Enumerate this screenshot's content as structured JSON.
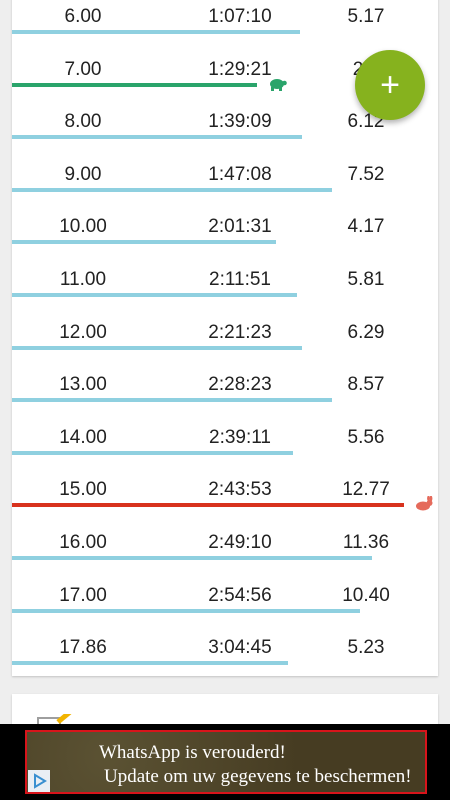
{
  "splits": [
    {
      "km": "6.00",
      "time": "1:07:10",
      "pace": "5.17",
      "bar_fraction": 0.677
    },
    {
      "km": "7.00",
      "time": "1:29:21",
      "pace": "2.7",
      "bar_fraction": 0.575,
      "marker": "turtle-icon",
      "bar_color": "#2aa46b"
    },
    {
      "km": "8.00",
      "time": "1:39:09",
      "pace": "6.12",
      "bar_fraction": 0.681
    },
    {
      "km": "9.00",
      "time": "1:47:08",
      "pace": "7.52",
      "bar_fraction": 0.75
    },
    {
      "km": "10.00",
      "time": "2:01:31",
      "pace": "4.17",
      "bar_fraction": 0.62
    },
    {
      "km": "11.00",
      "time": "2:11:51",
      "pace": "5.81",
      "bar_fraction": 0.669
    },
    {
      "km": "12.00",
      "time": "2:21:23",
      "pace": "6.29",
      "bar_fraction": 0.681
    },
    {
      "km": "13.00",
      "time": "2:28:23",
      "pace": "8.57",
      "bar_fraction": 0.75
    },
    {
      "km": "14.00",
      "time": "2:39:11",
      "pace": "5.56",
      "bar_fraction": 0.66
    },
    {
      "km": "15.00",
      "time": "2:43:53",
      "pace": "12.77",
      "bar_fraction": 0.92,
      "marker": "rabbit-icon",
      "bar_color": "#d8321d"
    },
    {
      "km": "16.00",
      "time": "2:49:10",
      "pace": "11.36",
      "bar_fraction": 0.845
    },
    {
      "km": "17.00",
      "time": "2:54:56",
      "pace": "10.40",
      "bar_fraction": 0.817
    },
    {
      "km": "17.86",
      "time": "3:04:45",
      "pace": "5.23",
      "bar_fraction": 0.648
    }
  ],
  "colors": {
    "bar": "#8fd0e0",
    "slowest": "#2aa46b",
    "fastest": "#d8321d",
    "fab": "#86b21e"
  },
  "fab": {
    "label": "+",
    "icon": "plus-icon"
  },
  "ad": {
    "line1": "WhatsApp is verouderd!",
    "line2": "Update om uw gegevens te beschermen!",
    "choices_icon": "ad-choices-icon"
  },
  "second_card": {
    "icon": "note-edit-icon"
  }
}
